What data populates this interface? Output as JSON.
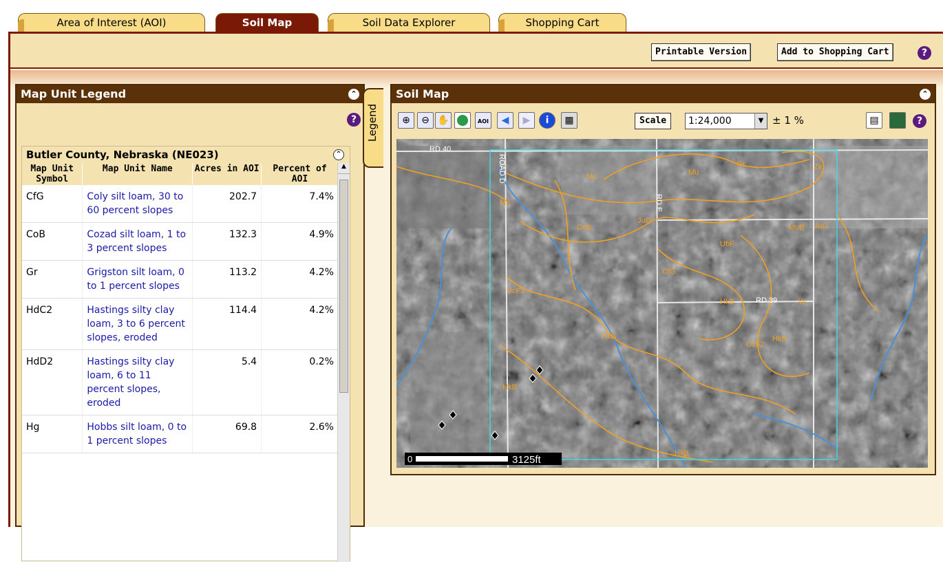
{
  "tabs": [
    {
      "label": "Area of Interest (AOI)",
      "active": false
    },
    {
      "label": "Soil Map",
      "active": true
    },
    {
      "label": "Soil Data Explorer",
      "active": false
    },
    {
      "label": "Shopping Cart",
      "active": false
    }
  ],
  "toolbar": {
    "printable_label": "Printable Version",
    "add_cart_label": "Add to Shopping Cart",
    "help": "?"
  },
  "legend_panel": {
    "title": "Map Unit Legend",
    "help": "?",
    "county": "Butler County, Nebraska (NE023)",
    "columns": [
      "Map Unit Symbol",
      "Map Unit Name",
      "Acres in AOI",
      "Percent of AOI"
    ],
    "rows": [
      {
        "symbol": "CfG",
        "name": "Coly silt loam, 30 to 60 percent slopes",
        "acres": "202.7",
        "percent": "7.4%"
      },
      {
        "symbol": "CoB",
        "name": "Cozad silt loam, 1 to 3 percent slopes",
        "acres": "132.3",
        "percent": "4.9%"
      },
      {
        "symbol": "Gr",
        "name": "Grigston silt loam, 0 to 1 percent slopes",
        "acres": "113.2",
        "percent": "4.2%"
      },
      {
        "symbol": "HdC2",
        "name": "Hastings silty clay loam, 3 to 6 percent slopes, eroded",
        "acres": "114.4",
        "percent": "4.2%"
      },
      {
        "symbol": "HdD2",
        "name": "Hastings silty clay loam, 6 to 11 percent slopes, eroded",
        "acres": "5.4",
        "percent": "0.2%"
      },
      {
        "symbol": "Hg",
        "name": "Hobbs silt loam, 0 to 1 percent slopes",
        "acres": "69.8",
        "percent": "2.6%"
      }
    ]
  },
  "side_tab": {
    "label": "Legend"
  },
  "map_panel": {
    "title": "Soil Map",
    "scale_button": "Scale",
    "scale_value": "1:24,000",
    "tolerance": "± 1 %",
    "scalebar_start": "0",
    "scalebar_end": "3125ft",
    "road_labels": [
      "RD 40",
      "ROAD D",
      "RD E",
      "RD 39"
    ],
    "unit_labels": [
      "Mu",
      "Mu",
      "Mu",
      "Gr",
      "Zk",
      "CoB",
      "JuG",
      "MuB",
      "JuG",
      "UbF",
      "CfG",
      "UcF2",
      "HkB",
      "HkB",
      "W",
      "UcF2",
      "HkB",
      "HkB",
      "HkB"
    ]
  },
  "colors": {
    "accent": "#7a1a06",
    "panel_header": "#5a3108",
    "tab_bg": "#f8dc88",
    "link": "#1a1aa8",
    "soil_line": "#f2a020",
    "aoi_line": "#40d8e8",
    "water": "#4a90d8"
  }
}
